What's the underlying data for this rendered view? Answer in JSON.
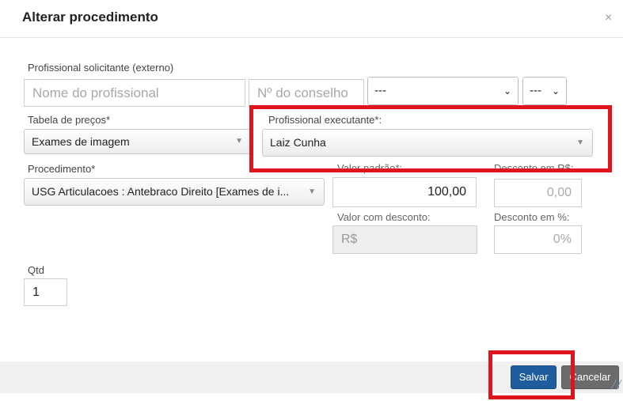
{
  "dialog": {
    "title": "Alterar procedimento",
    "close_glyph": "×"
  },
  "form": {
    "profissional_solicitante": {
      "label": "Profissional solicitante (externo)",
      "name_placeholder": "Nome do profissional",
      "conselho_placeholder": "Nº do conselho",
      "conselho_select": "---",
      "uf_select": "---"
    },
    "tabela_precos": {
      "label": "Tabela de preços*",
      "value": "Exames de imagem"
    },
    "profissional_executante": {
      "label": "Profissional executante*:",
      "value": "Laiz Cunha"
    },
    "procedimento": {
      "label": "Procedimento*",
      "value": "USG Articulacoes : Antebraco Direito [Exames de i..."
    },
    "valor_padrao": {
      "label": "Valor padrão*:",
      "value": "100,00"
    },
    "desconto_rs": {
      "label": "Desconto em R$:",
      "value": "0,00"
    },
    "valor_com_desconto": {
      "label": "Valor com desconto:",
      "value": "R$"
    },
    "desconto_pct": {
      "label": "Desconto em %:",
      "value": "0%"
    },
    "qtd": {
      "label": "Qtd",
      "value": "1"
    }
  },
  "footer": {
    "save_label": "Salvar",
    "cancel_label": "Cancelar"
  },
  "colors": {
    "highlight": "#e0141c",
    "primary": "#1f5c9e",
    "secondary": "#6b6b6b"
  }
}
